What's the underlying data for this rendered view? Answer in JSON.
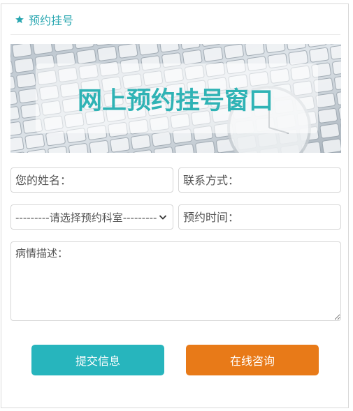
{
  "header": {
    "title": "预约挂号",
    "icon": "star-icon",
    "accent": "#2aa7b1"
  },
  "banner": {
    "text": "网上预约挂号窗口",
    "image": "keyboard-and-clock-banner"
  },
  "form": {
    "name_placeholder": "您的姓名：",
    "contact_placeholder": "联系方式：",
    "department_selected": "---------请选择预约科室---------",
    "time_placeholder": "预约时间：",
    "description_placeholder": "病情描述："
  },
  "buttons": {
    "submit_label": "提交信息",
    "submit_color": "#27b5bd",
    "consult_label": "在线咨询",
    "consult_color": "#e87a18"
  }
}
